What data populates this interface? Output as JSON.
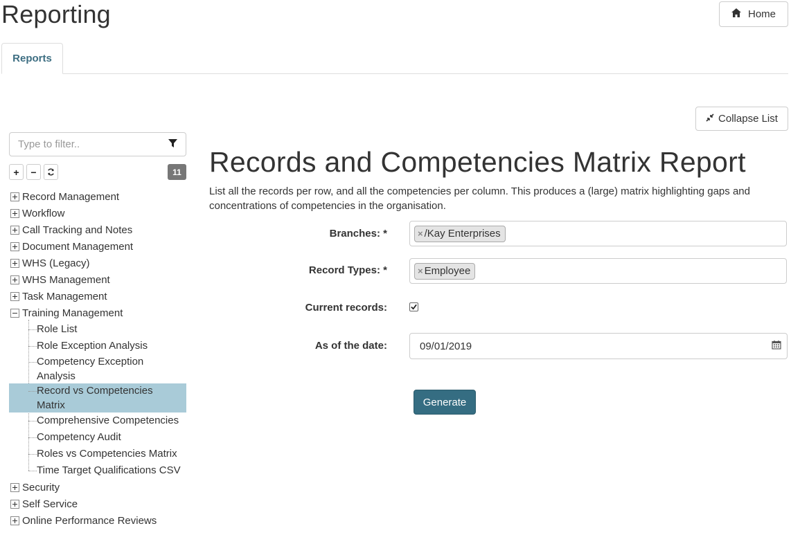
{
  "header": {
    "title": "Reporting",
    "home_label": "Home"
  },
  "tabs": [
    {
      "label": "Reports",
      "active": true
    }
  ],
  "collapse_label": "Collapse List",
  "sidebar": {
    "filter_placeholder": "Type to filter..",
    "count": "11",
    "tools": [
      "+",
      "−",
      "↻"
    ],
    "groups": [
      {
        "label": "Record Management",
        "expanded": false
      },
      {
        "label": "Workflow",
        "expanded": false
      },
      {
        "label": "Call Tracking and Notes",
        "expanded": false
      },
      {
        "label": "Document Management",
        "expanded": false
      },
      {
        "label": "WHS (Legacy)",
        "expanded": false
      },
      {
        "label": "WHS Management",
        "expanded": false
      },
      {
        "label": "Task Management",
        "expanded": false
      },
      {
        "label": "Training Management",
        "expanded": true
      },
      {
        "label": "Security",
        "expanded": false
      },
      {
        "label": "Self Service",
        "expanded": false
      },
      {
        "label": "Online Performance Reviews",
        "expanded": false
      }
    ],
    "training_children": [
      {
        "line1": "Role List",
        "line2": ""
      },
      {
        "line1": "Role Exception Analysis",
        "line2": ""
      },
      {
        "line1": "Competency Exception",
        "line2": "Analysis"
      },
      {
        "line1": "Record vs Competencies",
        "line2": "Matrix",
        "selected": true
      },
      {
        "line1": "Comprehensive Competencies",
        "line2": ""
      },
      {
        "line1": "Competency Audit",
        "line2": ""
      },
      {
        "line1": "Roles vs Competencies Matrix",
        "line2": ""
      },
      {
        "line1": "Time Target Qualifications CSV",
        "line2": ""
      }
    ]
  },
  "report": {
    "title": "Records and Competencies Matrix Report",
    "description": "List all the records per row, and all the competencies per column. This produces a (large) matrix highlighting gaps and concentrations of competencies in the organisation.",
    "fields": {
      "branches_label": "Branches: *",
      "branches_tag": "/Kay Enterprises",
      "record_types_label": "Record Types: *",
      "record_types_tag": "Employee",
      "current_records_label": "Current records:",
      "current_records_checked": true,
      "date_label": "As of the date:",
      "date_value": "09/01/2019"
    },
    "generate_label": "Generate"
  },
  "colors": {
    "accent": "#356d82",
    "tab_text": "#3d6e82",
    "selected_bg": "#a9cbd8",
    "badge": "#777777"
  }
}
